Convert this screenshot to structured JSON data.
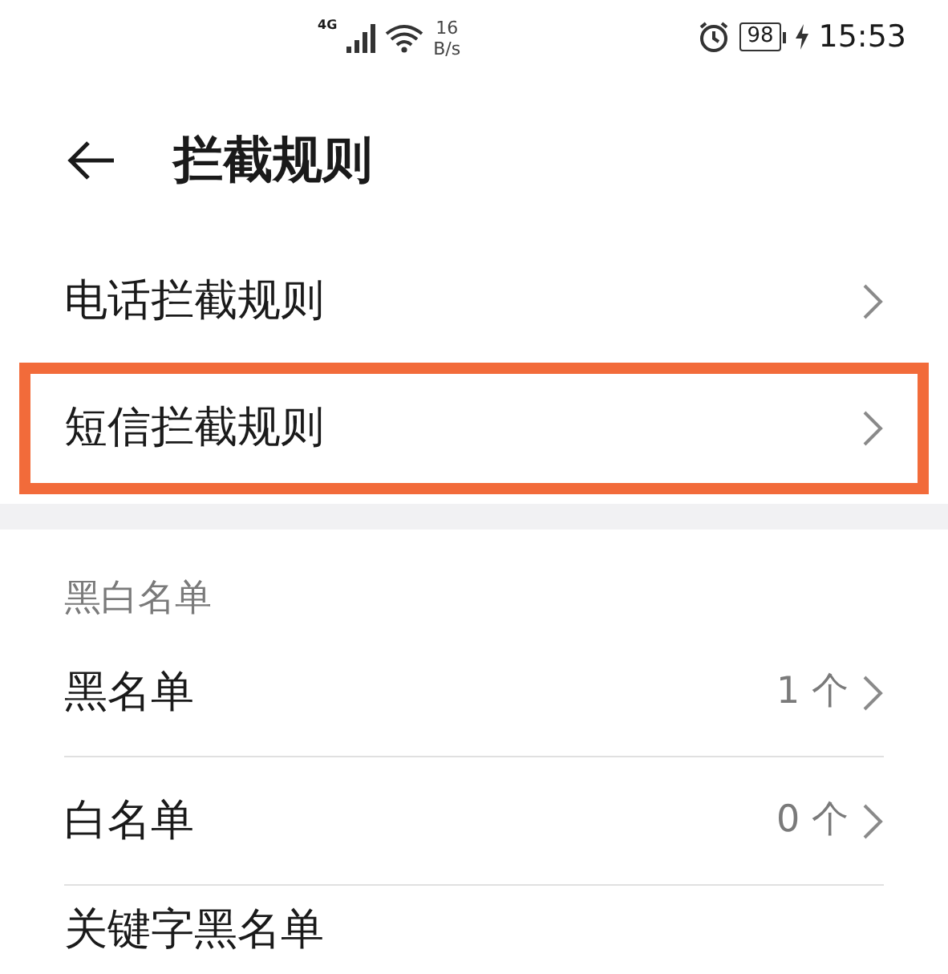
{
  "status_bar": {
    "network": "4G",
    "speed_value": "16",
    "speed_unit": "B/s",
    "battery": "98",
    "time": "15:53"
  },
  "header": {
    "title": "拦截规则"
  },
  "rule_items": [
    {
      "label": "电话拦截规则",
      "highlighted": false
    },
    {
      "label": "短信拦截规则",
      "highlighted": true
    }
  ],
  "section": {
    "title": "黑白名单"
  },
  "list_items": [
    {
      "label": "黑名单",
      "count": "1 个"
    },
    {
      "label": "白名单",
      "count": "0 个"
    },
    {
      "label": "关键字黑名单"
    }
  ]
}
